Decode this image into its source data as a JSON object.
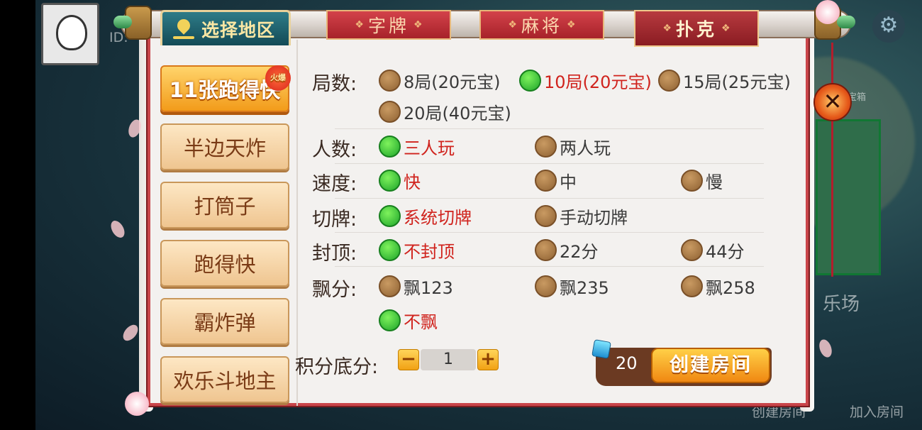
{
  "region": {
    "label": "选择地区"
  },
  "tabs": [
    {
      "label": "字牌",
      "active": false
    },
    {
      "label": "麻将",
      "active": false
    },
    {
      "label": "扑克",
      "active": true
    }
  ],
  "games": [
    {
      "label": "11张跑得快",
      "active": true,
      "badge": "火爆"
    },
    {
      "label": "半边天炸",
      "active": false
    },
    {
      "label": "打筒子",
      "active": false
    },
    {
      "label": "跑得快",
      "active": false
    },
    {
      "label": "霸炸弹",
      "active": false
    },
    {
      "label": "欢乐斗地主",
      "active": false
    }
  ],
  "options": {
    "rounds": {
      "label": "局数:",
      "choices": [
        "8局(20元宝)",
        "10局(20元宝)",
        "15局(25元宝)",
        "20局(40元宝)"
      ],
      "selected": 1
    },
    "players": {
      "label": "人数:",
      "choices": [
        "三人玩",
        "两人玩"
      ],
      "selected": 0
    },
    "speed": {
      "label": "速度:",
      "choices": [
        "快",
        "中",
        "慢"
      ],
      "selected": 0
    },
    "cut": {
      "label": "切牌:",
      "choices": [
        "系统切牌",
        "手动切牌"
      ],
      "selected": 0
    },
    "cap": {
      "label": "封顶:",
      "choices": [
        "不封顶",
        "22分",
        "44分"
      ],
      "selected": 0
    },
    "float": {
      "label": "飘分:",
      "choices": [
        "飘123",
        "飘235",
        "飘258",
        "不飘"
      ],
      "selected": 3
    }
  },
  "score": {
    "label": "积分底分:",
    "value": "1",
    "minus": "−",
    "plus": "+"
  },
  "create": {
    "cost": "20",
    "label": "创建房间"
  },
  "close": {
    "glyph": "✕"
  },
  "background": {
    "id_label": "ID:",
    "join_room": "加入房间",
    "create_room": "创建房间",
    "hall": "乐场",
    "treasure": "宝宝箱"
  },
  "colors": {
    "selected_text": "#d0231d",
    "accent_red": "#c9454a",
    "accent_green": "#1ea52a"
  }
}
